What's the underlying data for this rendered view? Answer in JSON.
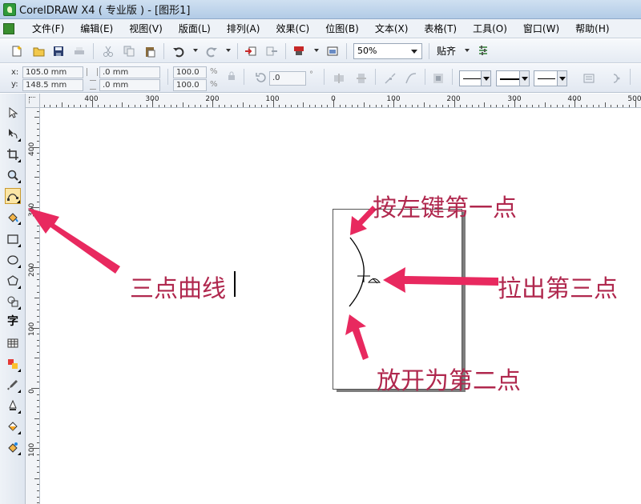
{
  "window": {
    "title": "CorelDRAW X4 ( 专业版 ) - [图形1]"
  },
  "menu": {
    "items": [
      "文件(F)",
      "编辑(E)",
      "视图(V)",
      "版面(L)",
      "排列(A)",
      "效果(C)",
      "位图(B)",
      "文本(X)",
      "表格(T)",
      "工具(O)",
      "窗口(W)",
      "帮助(H)"
    ]
  },
  "toolbar": {
    "zoom_value": "50%",
    "snap_label": "贴齐"
  },
  "property_bar": {
    "x_label": "x:",
    "x_value": "105.0 mm",
    "y_label": "y:",
    "y_value": "148.5 mm",
    "width_value": ".0 mm",
    "height_value": ".0 mm",
    "scale_x": "100.0",
    "scale_y": "100.0",
    "percent": "%",
    "angle_value": ".0",
    "degree": "°"
  },
  "rulers": {
    "horizontal": [
      "400",
      "300",
      "200",
      "100",
      "0",
      "100",
      "200",
      "300",
      "400",
      "500"
    ],
    "vertical": [
      "400",
      "300",
      "200",
      "100",
      "0",
      "100"
    ]
  },
  "annotations": {
    "tool_label": "三点曲线",
    "first_point": "按左键第一点",
    "third_point": "拉出第三点",
    "second_point": "放开为第二点"
  },
  "colors": {
    "annotation_text": "#b0284e",
    "arrow": "#e8295f"
  }
}
